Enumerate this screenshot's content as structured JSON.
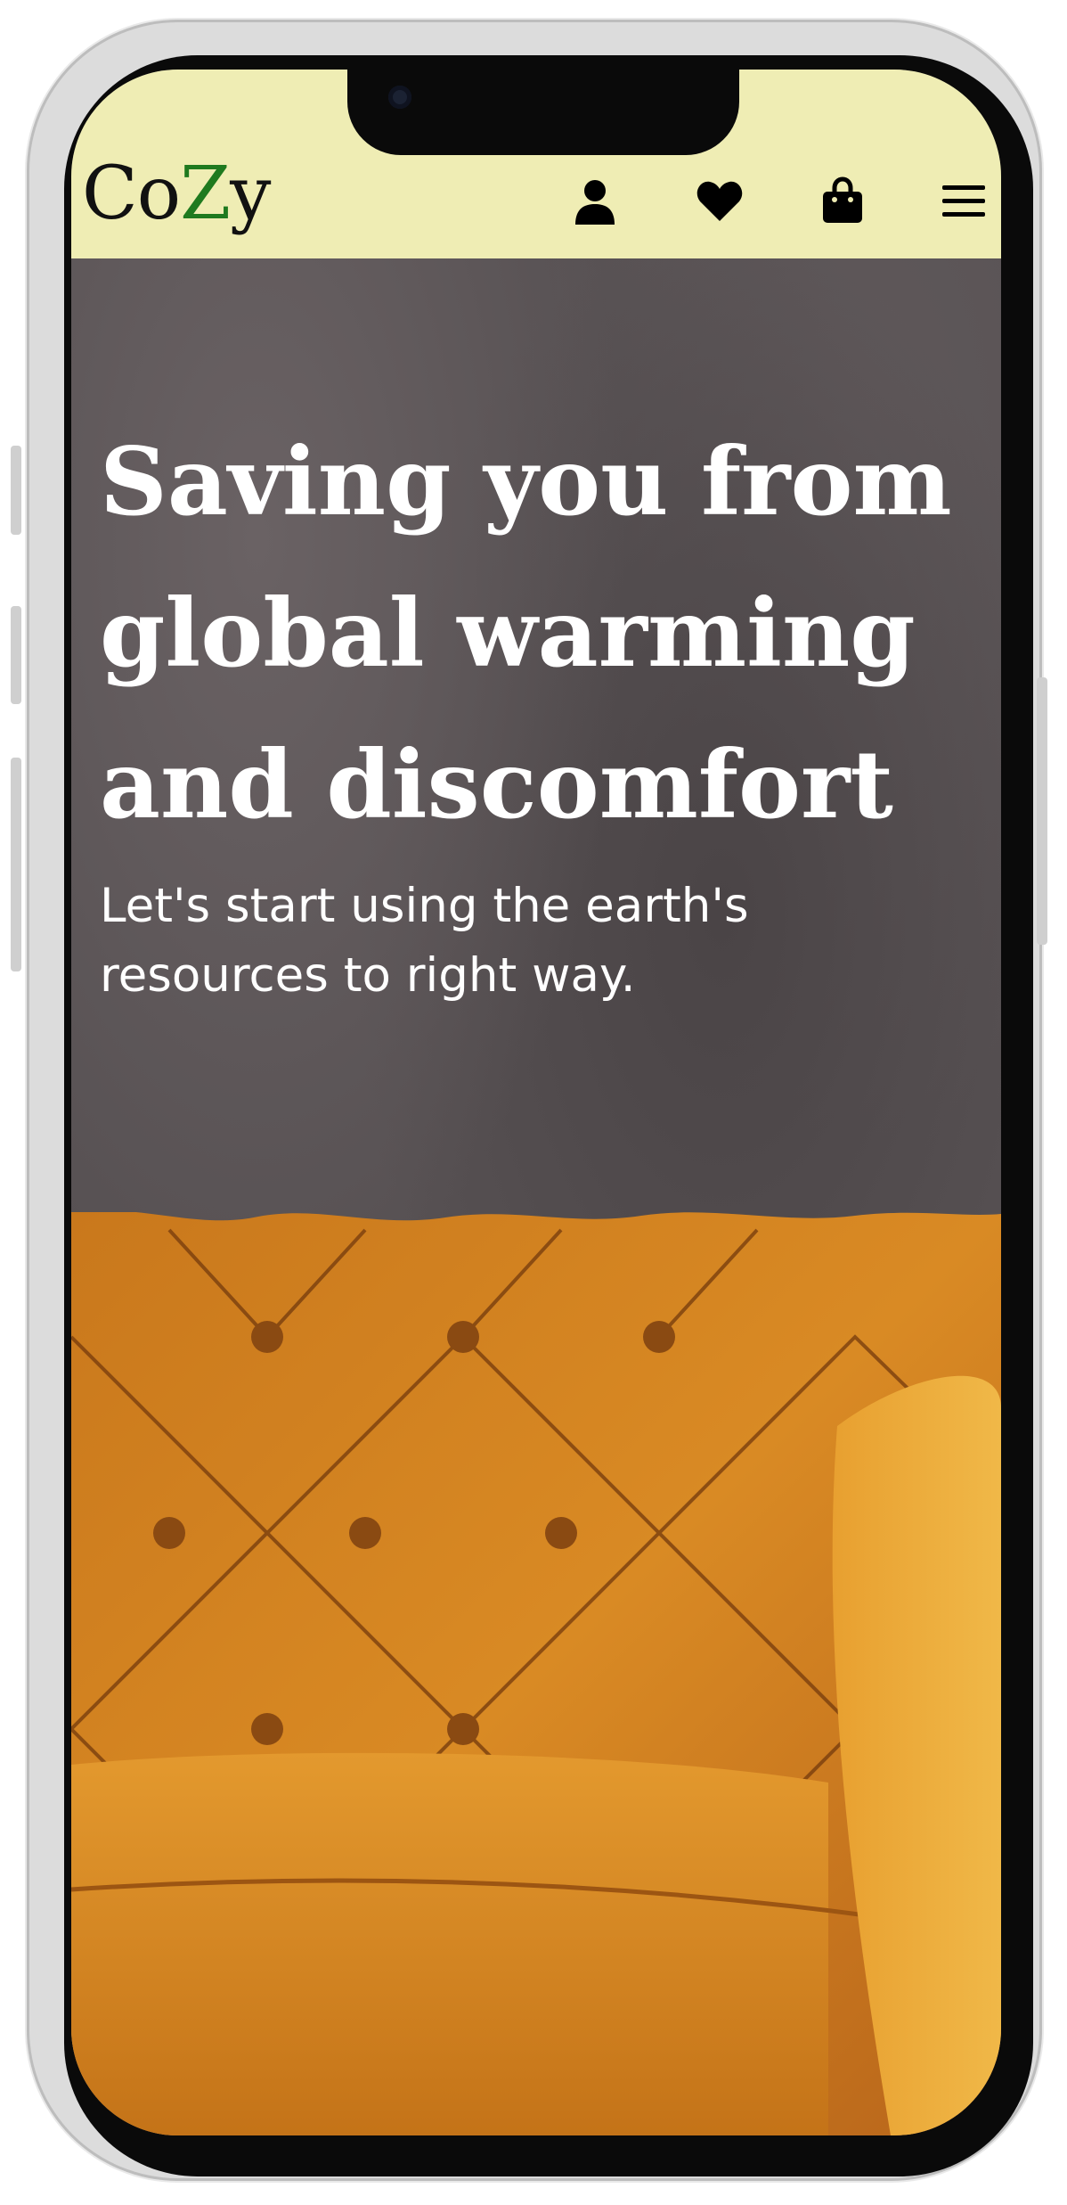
{
  "brand": {
    "logo_prefix": "Co",
    "logo_accent": "Z",
    "logo_suffix": "y",
    "accent_color": "#1f7a1f",
    "navbar_color": "#efedb4"
  },
  "navbar": {
    "icons": [
      "user-icon",
      "heart-icon",
      "shopping-bag-icon",
      "menu-icon"
    ]
  },
  "hero": {
    "headline": "Saving you from global warming and discomfort",
    "subline": "Let's start using the earth's resources to right way."
  }
}
